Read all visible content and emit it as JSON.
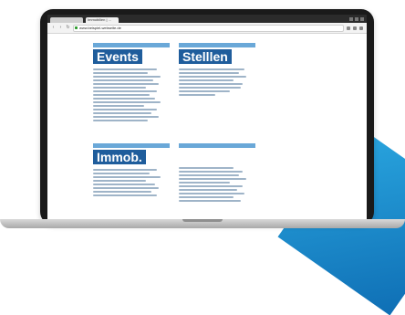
{
  "browser": {
    "tab_active_label": "Immobilien | ...",
    "tab_inactive_label": "",
    "url": "www.beispiel-webseite.de"
  },
  "panels": {
    "events": {
      "title": "Events"
    },
    "stellen": {
      "title": "Stelllen"
    },
    "immob": {
      "title": "Immob."
    },
    "fourth": {
      "title": ""
    }
  },
  "colors": {
    "header_bar": "#6aa8d8",
    "title_bg": "#1f5d9c",
    "accent": "#2aa7e0"
  }
}
